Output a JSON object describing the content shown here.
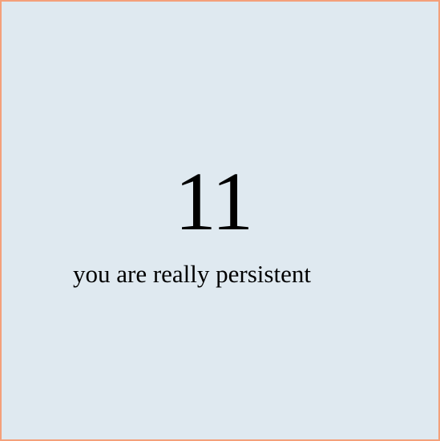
{
  "counter": {
    "value": "11"
  },
  "message": {
    "text": "you are really persistent"
  },
  "colors": {
    "background": "#dfe9f0",
    "border": "#f4a07a",
    "text": "#000000"
  }
}
